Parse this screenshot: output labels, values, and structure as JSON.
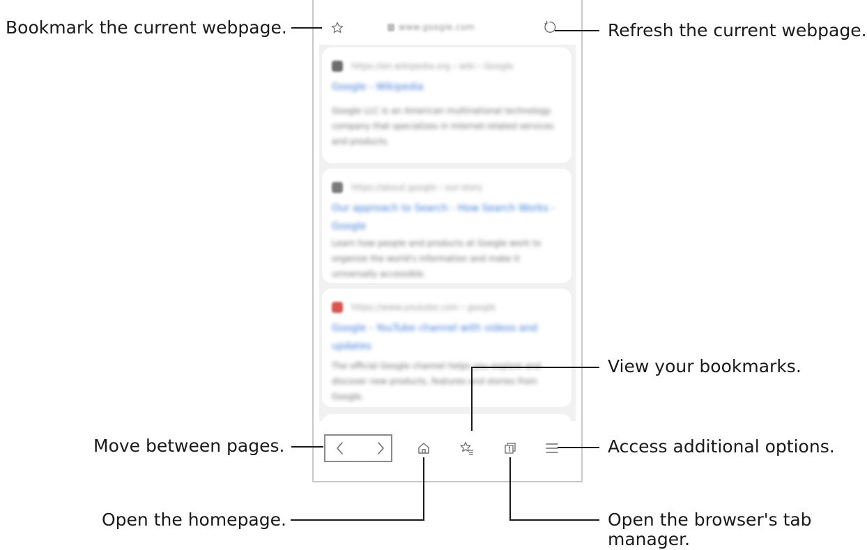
{
  "browser": {
    "url": "www.google.com",
    "cards": [
      {
        "source": "https://en.wikipedia.org › wiki › Google",
        "title": "Google - Wikipedia",
        "snippet": "Google LLC is an American multinational technology company that specializes in Internet-related services and products."
      },
      {
        "source": "https://about.google › our-story",
        "title": "Our approach to Search - How Search Works - Google",
        "snippet": "Learn how people and products at Google work to organize the world's information and make it universally accessible."
      },
      {
        "source": "https://www.youtube.com › google",
        "title": "Google - YouTube channel with videos and updates",
        "snippet": "The official Google channel helps you explore and discover new products, features and stories from Google."
      }
    ],
    "colors": {
      "frame": "#c9c9c9",
      "content_bg": "#f1f1f1",
      "link": "#3d7ad6",
      "icon": "#6b6b6b"
    }
  },
  "callouts": {
    "bookmark_current": "Bookmark the current webpage.",
    "refresh": "Refresh the current webpage.",
    "view_bookmarks": "View your bookmarks.",
    "move_pages": "Move between pages.",
    "additional_options": "Access additional options.",
    "homepage": "Open the homepage.",
    "tab_manager_line1": "Open the browser's tab",
    "tab_manager_line2": "manager."
  },
  "icons": [
    "star-outline-icon",
    "refresh-icon",
    "back-chevron-icon",
    "forward-chevron-icon",
    "home-icon",
    "bookmarks-list-icon",
    "tabs-icon",
    "menu-icon"
  ]
}
